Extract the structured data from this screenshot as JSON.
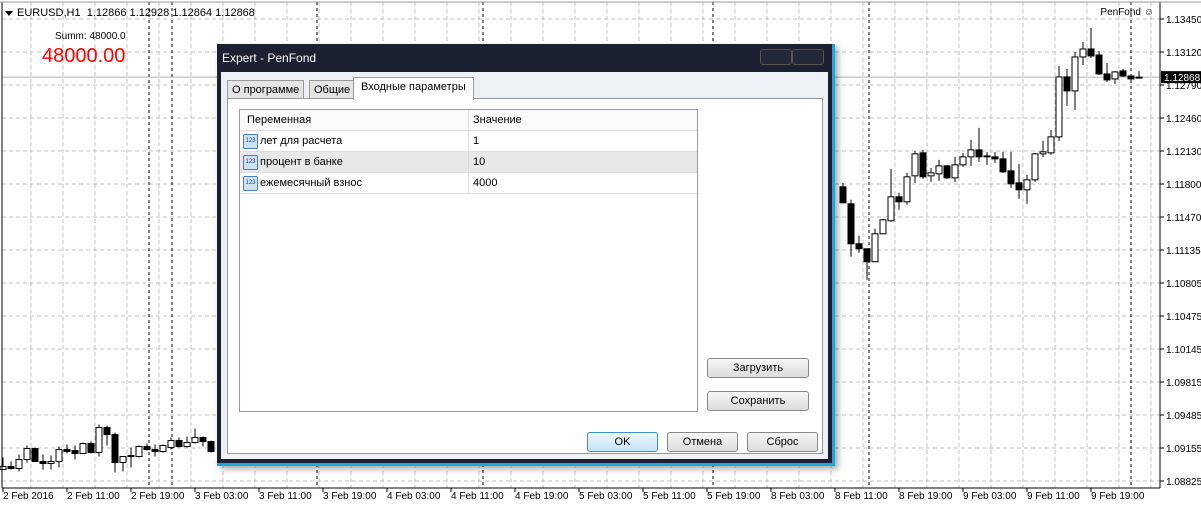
{
  "chart_header": {
    "symbol": "EURUSD,H1",
    "ohlc": "1.12866 1.12928 1.12864 1.12868"
  },
  "indicator": {
    "summ_label": "Summ: 48000.0",
    "big_value": "48000.00",
    "big_color": "#ff0000"
  },
  "expert_label": "PenFond",
  "expert_icon": "smiley-icon",
  "dialog": {
    "title": "Expert - PenFond",
    "tabs": [
      {
        "label": "О программе"
      },
      {
        "label": "Общие"
      },
      {
        "label": "Входные параметры",
        "active": true
      }
    ],
    "table": {
      "headers": [
        "Переменная",
        "Значение"
      ],
      "rows": [
        {
          "name": "лет для расчета",
          "value": "1",
          "icon": "integer-123-icon"
        },
        {
          "name": "процент в банке",
          "value": "10",
          "icon": "integer-123-icon"
        },
        {
          "name": "ежемесячный взнос",
          "value": "4000",
          "icon": "integer-123-icon"
        }
      ]
    },
    "icon_text": "123",
    "load_label": "Загрузить",
    "save_label": "Сохранить",
    "ok_label": "OK",
    "cancel_label": "Отмена",
    "reset_label": "Сброс"
  },
  "chart_data": {
    "type": "candlestick",
    "current_price": "1.12868",
    "ylim": [
      1.08825,
      1.1345
    ],
    "y_ticks": [
      "1.13450",
      "1.13120",
      "1.12790",
      "1.12460",
      "1.12130",
      "1.11800",
      "1.11470",
      "1.11135",
      "1.10805",
      "1.10475",
      "1.10145",
      "1.09815",
      "1.09485",
      "1.09155",
      "1.08825"
    ],
    "x_ticks": [
      "2 Feb 2016",
      "2 Feb 11:00",
      "2 Feb 19:00",
      "3 Feb 03:00",
      "3 Feb 11:00",
      "3 Feb 19:00",
      "4 Feb 03:00",
      "4 Feb 11:00",
      "4 Feb 19:00",
      "5 Feb 03:00",
      "5 Feb 11:00",
      "5 Feb 19:00",
      "8 Feb 03:00",
      "8 Feb 11:00",
      "8 Feb 19:00",
      "9 Feb 03:00",
      "9 Feb 11:00",
      "9 Feb 19:00"
    ],
    "grid": true,
    "colors": {
      "bull": "#ffffff",
      "bear": "#000000"
    },
    "segments": [
      {
        "start_bar": 0,
        "ohlc": [
          [
            1.0894,
            1.0906,
            1.0894,
            1.0897
          ],
          [
            1.0897,
            1.0902,
            1.0894,
            1.0895
          ],
          [
            1.0895,
            1.0909,
            1.0892,
            1.0904
          ],
          [
            1.0904,
            1.0918,
            1.0901,
            1.0915
          ],
          [
            1.0915,
            1.0916,
            1.0902,
            1.0902
          ],
          [
            1.0902,
            1.0909,
            1.0894,
            1.09
          ],
          [
            1.09,
            1.0908,
            1.0894,
            1.0902
          ],
          [
            1.0902,
            1.0917,
            1.0896,
            1.0914
          ],
          [
            1.0914,
            1.0919,
            1.091,
            1.0912
          ],
          [
            1.0913,
            1.0918,
            1.0904,
            1.091
          ],
          [
            1.091,
            1.0921,
            1.091,
            1.092
          ],
          [
            1.092,
            1.0922,
            1.091,
            1.0911
          ],
          [
            1.0911,
            1.0939,
            1.0907,
            1.0936
          ],
          [
            1.0936,
            1.0938,
            1.0918,
            1.0929
          ],
          [
            1.0929,
            1.0931,
            1.0891,
            1.0901
          ],
          [
            1.0901,
            1.0907,
            1.0892,
            1.0907
          ],
          [
            1.0908,
            1.0916,
            1.0896,
            1.0907
          ],
          [
            1.0907,
            1.0918,
            1.0906,
            1.0917
          ],
          [
            1.0917,
            1.092,
            1.0913,
            1.0914
          ],
          [
            1.0914,
            1.0919,
            1.0907,
            1.0912
          ],
          [
            1.0912,
            1.0919,
            1.0911,
            1.0918
          ],
          [
            1.0916,
            1.0926,
            1.0914,
            1.0923
          ],
          [
            1.0923,
            1.0926,
            1.0916,
            1.0917
          ],
          [
            1.0917,
            1.0927,
            1.0916,
            1.0921
          ],
          [
            1.0921,
            1.0935,
            1.092,
            1.0926
          ],
          [
            1.0926,
            1.0927,
            1.0917,
            1.0922
          ],
          [
            1.0922,
            1.0923,
            1.0911,
            1.0912
          ]
        ]
      },
      {
        "start_bar": 105,
        "ohlc": [
          [
            1.1177,
            1.1181,
            1.1161,
            1.1161
          ],
          [
            1.116,
            1.1164,
            1.1107,
            1.112
          ],
          [
            1.112,
            1.1128,
            1.1111,
            1.1115
          ],
          [
            1.1115,
            1.1115,
            1.1084,
            1.1102
          ],
          [
            1.1102,
            1.1135,
            1.1102,
            1.113
          ],
          [
            1.113,
            1.1145,
            1.113,
            1.1144
          ],
          [
            1.1143,
            1.1195,
            1.1142,
            1.1167
          ],
          [
            1.1167,
            1.1171,
            1.1154,
            1.1162
          ],
          [
            1.1162,
            1.1191,
            1.1159,
            1.1187
          ],
          [
            1.1188,
            1.1213,
            1.1181,
            1.121
          ],
          [
            1.1211,
            1.1214,
            1.1185,
            1.1187
          ],
          [
            1.1188,
            1.1196,
            1.1182,
            1.1191
          ],
          [
            1.119,
            1.1204,
            1.1183,
            1.1198
          ],
          [
            1.1198,
            1.1199,
            1.1185,
            1.1186
          ],
          [
            1.1186,
            1.1207,
            1.1182,
            1.1199
          ],
          [
            1.1199,
            1.1211,
            1.1197,
            1.1207
          ],
          [
            1.1207,
            1.1224,
            1.1198,
            1.1214
          ],
          [
            1.1214,
            1.1236,
            1.1202,
            1.1207
          ],
          [
            1.1208,
            1.1212,
            1.1199,
            1.1207
          ],
          [
            1.1207,
            1.1212,
            1.1201,
            1.1205
          ],
          [
            1.1205,
            1.1212,
            1.1191,
            1.1192
          ],
          [
            1.1193,
            1.1212,
            1.1176,
            1.118
          ],
          [
            1.1181,
            1.12,
            1.1165,
            1.1174
          ],
          [
            1.1174,
            1.1189,
            1.116,
            1.1184
          ],
          [
            1.1184,
            1.1211,
            1.1182,
            1.121
          ],
          [
            1.121,
            1.1223,
            1.1207,
            1.1212
          ],
          [
            1.1211,
            1.1234,
            1.1209,
            1.1227
          ],
          [
            1.1227,
            1.1298,
            1.1223,
            1.1287
          ],
          [
            1.1287,
            1.1295,
            1.1258,
            1.1273
          ],
          [
            1.1273,
            1.1312,
            1.1254,
            1.1307
          ],
          [
            1.1307,
            1.1322,
            1.1299,
            1.1315
          ],
          [
            1.1315,
            1.1336,
            1.1306,
            1.1308
          ],
          [
            1.1309,
            1.1313,
            1.1289,
            1.129
          ],
          [
            1.129,
            1.1301,
            1.1282,
            1.1284
          ],
          [
            1.1285,
            1.1293,
            1.128,
            1.1292
          ],
          [
            1.1293,
            1.1295,
            1.1287,
            1.1288
          ],
          [
            1.1288,
            1.129,
            1.1284,
            1.1285
          ],
          [
            1.12866,
            1.12928,
            1.12864,
            1.12868
          ]
        ]
      }
    ]
  }
}
